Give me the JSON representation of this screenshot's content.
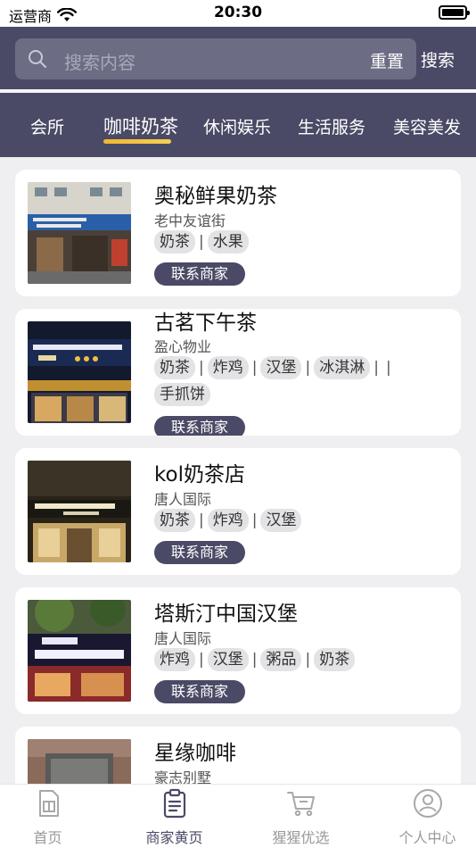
{
  "status_bar": {
    "carrier": "运营商",
    "time": "20:30"
  },
  "search": {
    "placeholder": "搜索内容",
    "reset_label": "重置",
    "search_label": "搜索"
  },
  "tabs": [
    {
      "label": "会所"
    },
    {
      "label": "咖啡奶茶"
    },
    {
      "label": "休闲娱乐"
    },
    {
      "label": "生活服务"
    },
    {
      "label": "美容美发"
    }
  ],
  "active_tab": "咖啡奶茶",
  "shops": [
    {
      "name": "奥秘鲜果奶茶",
      "area": "老中友谊街",
      "tags": [
        "奶茶",
        "水果"
      ],
      "trailing_sep": false,
      "contact_label": "联系商家"
    },
    {
      "name": "古茗下午茶",
      "area": "盈心物业",
      "tags": [
        "奶茶",
        "炸鸡",
        "汉堡",
        "冰淇淋",
        "手抓饼"
      ],
      "trailing_sep": true,
      "contact_label": "联系商家"
    },
    {
      "name": "kol奶茶店",
      "area": "唐人国际",
      "tags": [
        "奶茶",
        "炸鸡",
        "汉堡"
      ],
      "trailing_sep": false,
      "contact_label": "联系商家"
    },
    {
      "name": "塔斯汀中国汉堡",
      "area": "唐人国际",
      "tags": [
        "炸鸡",
        "汉堡",
        "粥品",
        "奶茶"
      ],
      "trailing_sep": false,
      "contact_label": "联系商家"
    },
    {
      "name": "星缘咖啡",
      "area": "豪志别墅",
      "tags": [],
      "trailing_sep": false,
      "contact_label": ""
    }
  ],
  "bottom_nav": [
    {
      "label": "首页",
      "icon": "sim-card-icon"
    },
    {
      "label": "商家黄页",
      "icon": "clipboard-icon"
    },
    {
      "label": "猩猩优选",
      "icon": "shopping-cart-icon"
    },
    {
      "label": "个人中心",
      "icon": "user-circle-icon"
    }
  ],
  "active_nav": "商家黄页",
  "colors": {
    "header": "#4a4a66",
    "accent_underline": "#f2b632",
    "background": "#efeff1"
  }
}
